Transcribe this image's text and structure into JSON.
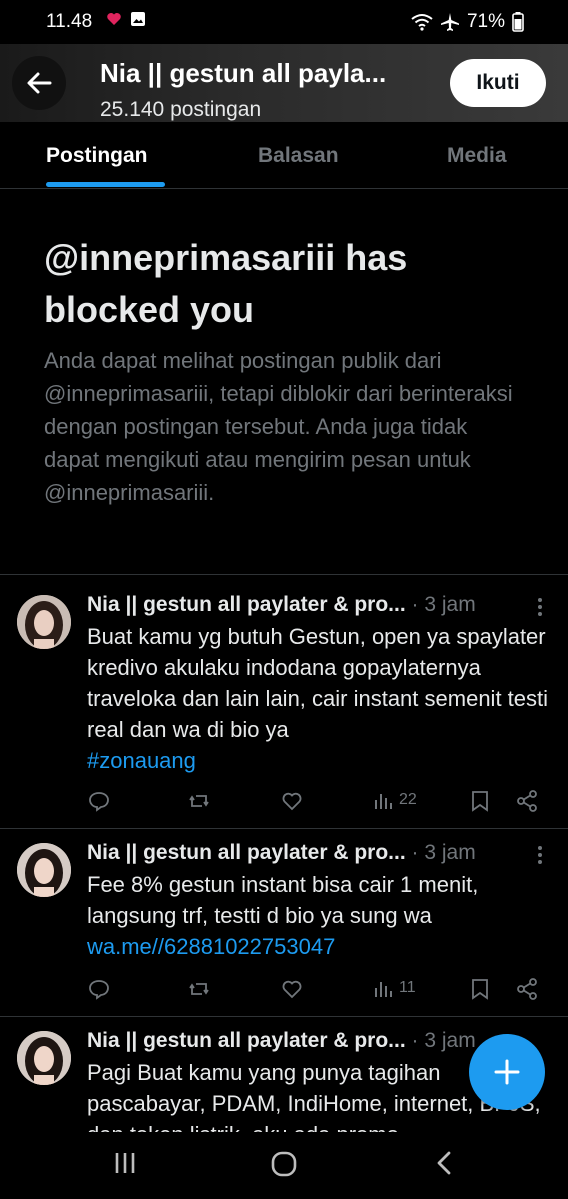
{
  "status_bar": {
    "time": "11.48",
    "battery": "71%"
  },
  "header": {
    "title": "Nia || gestun all payla...",
    "subtitle": "25.140 postingan",
    "follow_label": "Ikuti"
  },
  "tabs": [
    {
      "label": "Postingan",
      "active": true
    },
    {
      "label": "Balasan",
      "active": false
    },
    {
      "label": "Media",
      "active": false
    }
  ],
  "blocked": {
    "title": "@inneprimasariii has blocked you",
    "description": "Anda dapat melihat postingan publik dari @inneprimasariii, tetapi diblokir dari berinteraksi dengan postingan tersebut. Anda juga tidak dapat mengikuti atau mengirim pesan untuk @inneprimasariii."
  },
  "posts": [
    {
      "name": "Nia || gestun all paylater & pro...",
      "time": "· 3 jam",
      "text": "Buat kamu yg butuh Gestun, open ya spaylater kredivo akulaku indodana gopaylaternya traveloka dan lain lain, cair instant semenit testi real dan wa di bio ya",
      "link": "#zonauang",
      "views": "22"
    },
    {
      "name": "Nia || gestun all paylater & pro...",
      "time": "· 3 jam",
      "text": "Fee 8% gestun instant bisa cair 1 menit, langsung trf, testti d bio ya sung wa",
      "link": "wa.me//62881022753047",
      "views": "11"
    },
    {
      "name": "Nia || gestun all paylater & pro...",
      "time": "· 3 jam",
      "text": "Pagi Buat kamu yang punya tagihan pascabayar, PDAM, IndiHome, internet, BPJS, dan token listrik, aku ada promo"
    }
  ],
  "icons": {
    "back": "arrow-left-icon",
    "reply": "reply-icon",
    "repost": "repost-icon",
    "like": "heart-icon",
    "views": "views-icon",
    "bookmark": "bookmark-icon",
    "share": "share-icon",
    "fab": "plus-icon"
  },
  "colors": {
    "accent": "#1d9bf0",
    "muted": "#71767b",
    "background": "#000000"
  }
}
